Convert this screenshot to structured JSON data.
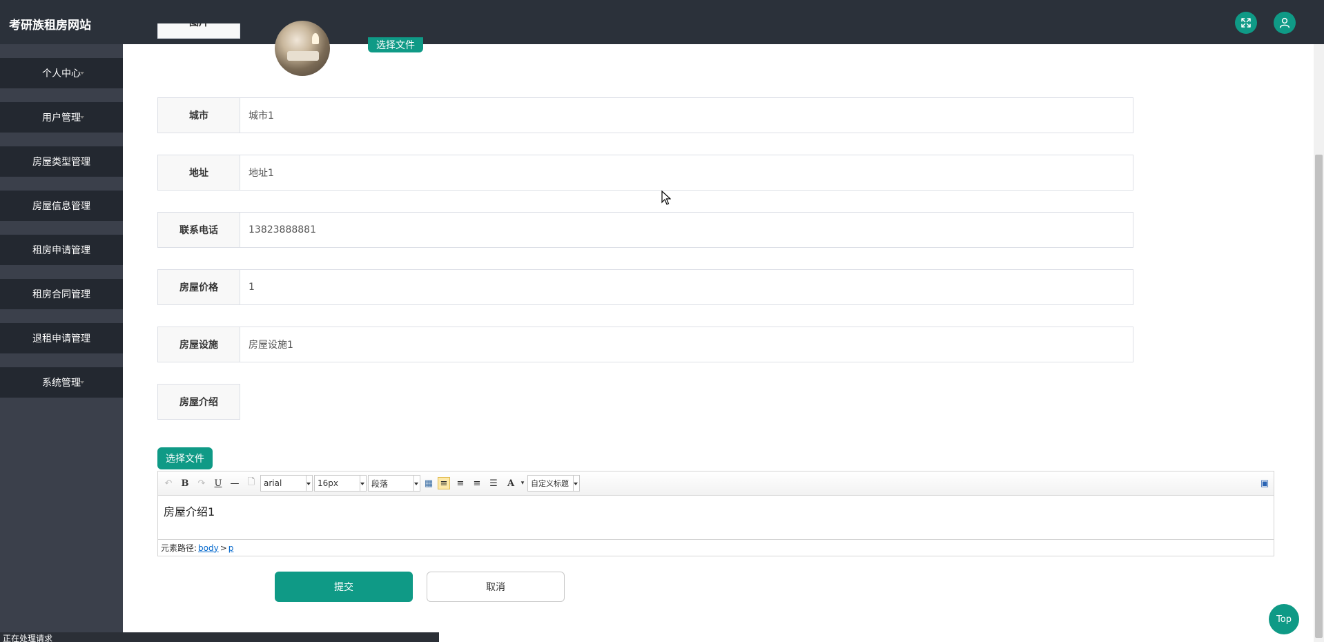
{
  "header": {
    "site_title": "考研族租房网站",
    "fullscreen_icon": "fullscreen-icon",
    "user_icon": "user-icon"
  },
  "sidebar": {
    "items": [
      {
        "label": "个人中心"
      },
      {
        "label": "用户管理"
      },
      {
        "label": "房屋类型管理"
      },
      {
        "label": "房屋信息管理"
      },
      {
        "label": "租房申请管理"
      },
      {
        "label": "租房合同管理"
      },
      {
        "label": "退租申请管理"
      },
      {
        "label": "系统管理"
      }
    ]
  },
  "form": {
    "image_field": {
      "label": "图片",
      "upload_label": "选择文件"
    },
    "fields": [
      {
        "label": "城市",
        "value": "城市1"
      },
      {
        "label": "地址",
        "value": "地址1"
      },
      {
        "label": "联系电话",
        "value": "13823888881"
      },
      {
        "label": "房屋价格",
        "value": "1"
      },
      {
        "label": "房屋设施",
        "value": "房屋设施1"
      }
    ],
    "intro": {
      "label": "房屋介绍",
      "upload_label": "选择文件",
      "editor": {
        "font_family": "arial",
        "font_size": "16px",
        "paragraph": "段落",
        "custom_title": "自定义标题",
        "content": "房屋介绍1",
        "path_label": "元素路径:",
        "path_body": "body",
        "path_sep": ">",
        "path_p": "p"
      }
    },
    "submit_label": "提交",
    "cancel_label": "取消"
  },
  "top_button": "Top",
  "status_bar": "正在处理请求",
  "colors": {
    "accent": "#0f9a86",
    "header_bg": "#2b313a",
    "sidebar_bg": "#3b404b",
    "menu_item_bg": "#232830"
  }
}
